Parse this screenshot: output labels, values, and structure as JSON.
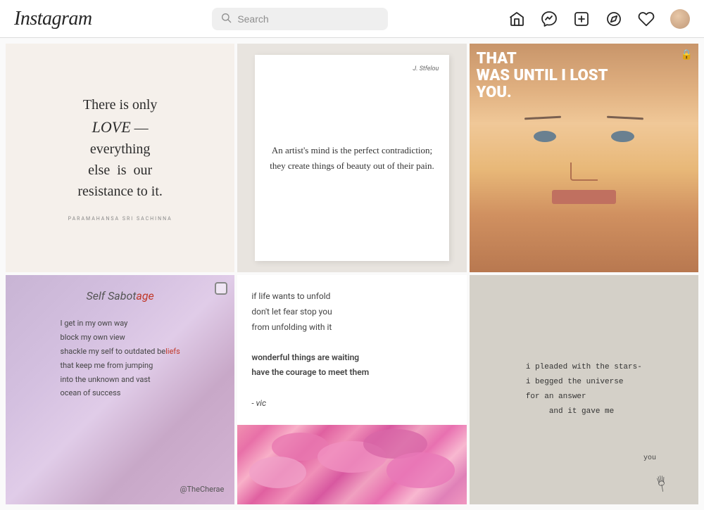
{
  "header": {
    "logo": "Instagram",
    "search": {
      "placeholder": "Search",
      "value": ""
    },
    "nav": {
      "home_label": "Home",
      "messenger_label": "Messenger",
      "add_label": "Add",
      "explore_label": "Explore",
      "heart_label": "Likes",
      "avatar_label": "Profile"
    }
  },
  "posts": [
    {
      "id": 1,
      "type": "quote",
      "main_text": "There is only LOVE — everything else is our resistance to it.",
      "author": "PARAMAHANSA SRI SACHINNA",
      "alt": "Love quote on cream background"
    },
    {
      "id": 2,
      "type": "book",
      "author_tag": "J. Stfelou",
      "text": "An artist's mind is the perfect contradiction; they create things of beauty out of their pain.",
      "alt": "Book quote about artists"
    },
    {
      "id": 3,
      "type": "portrait",
      "overlay": "THAT WAS UNTIL I LOST YOU.",
      "alt": "Portrait of woman with text overlay"
    },
    {
      "id": 4,
      "type": "quote",
      "title_part1": "Self Sabot",
      "title_highlight": "age",
      "text": "I get in my own way\nblock my own view\nshackle my self to outdated beliefs\nthat keep me from jumping\ninto the unknown and vast\nocean of success",
      "highlight_word": "beliefs",
      "handle": "@TheCherae",
      "alt": "Self Sabotage poem on purple gradient"
    },
    {
      "id": 5,
      "type": "flowers_poem",
      "poem_lines": [
        "if life wants to unfold",
        "don't let fear stop you",
        "from unfolding with it",
        "",
        "wonderful things are waiting",
        "have the courage to meet them",
        "",
        "- vic"
      ],
      "alt": "Poem over pink flowers"
    },
    {
      "id": 6,
      "type": "poem",
      "poem_lines": [
        "i pleaded with the stars-",
        "i begged the universe",
        "for an answer",
        "     and it gave me"
      ],
      "word": "you",
      "alt": "Poem with hand shadow"
    }
  ]
}
